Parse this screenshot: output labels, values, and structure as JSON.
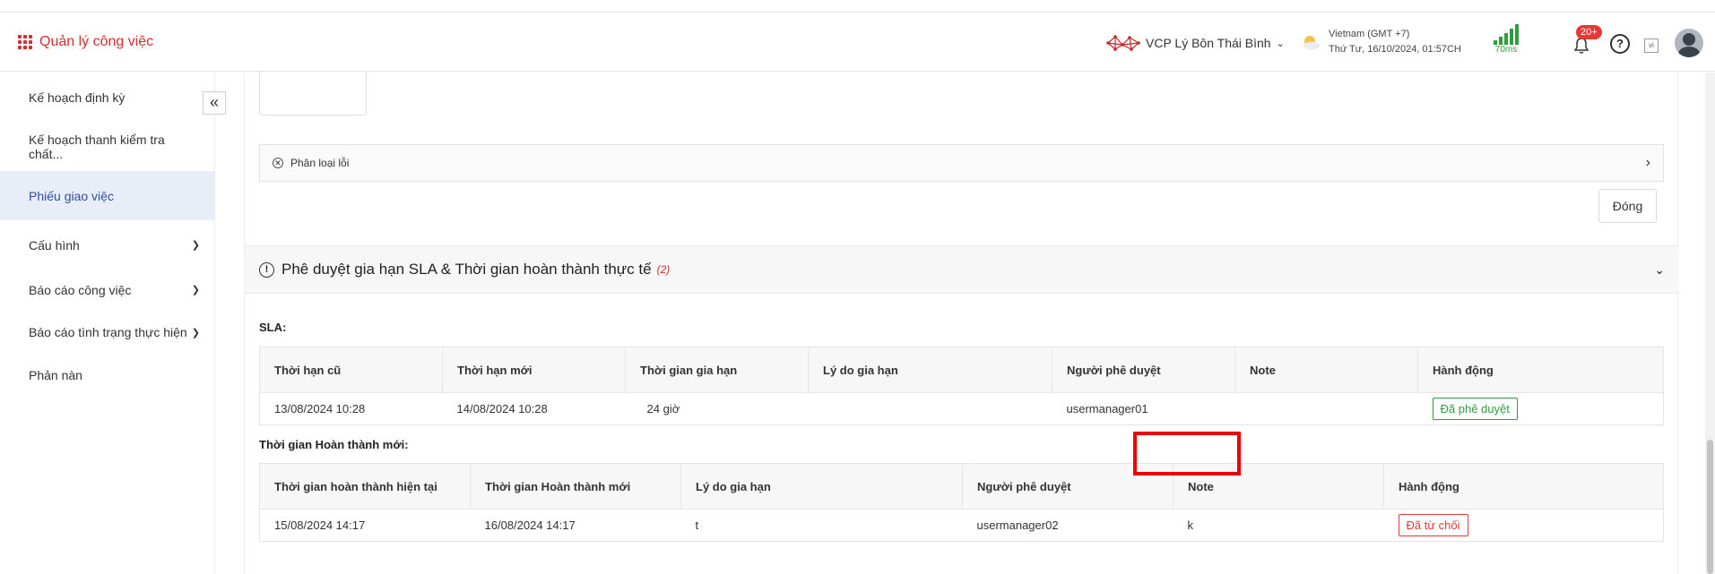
{
  "header": {
    "app_title": "Quản lý công việc",
    "org_name": "VCP Lý Bôn Thái Bình",
    "timezone": "Vietnam (GMT +7)",
    "datetime": "Thứ Tư, 16/10/2024, 01:57CH",
    "latency": "70ms",
    "notif_count": "20+",
    "help_glyph": "?",
    "lang_code": "vi"
  },
  "sidebar": {
    "items": [
      {
        "label": "Kế hoạch định kỳ"
      },
      {
        "label": "Kế hoạch thanh kiểm tra chất..."
      },
      {
        "label": "Phiếu giao việc"
      },
      {
        "label": "Cấu hình"
      },
      {
        "label": "Báo cáo công việc"
      },
      {
        "label": "Báo cáo tình trạng thực hiện"
      },
      {
        "label": "Phản nàn"
      }
    ],
    "collapse_glyph": "«"
  },
  "main": {
    "error_classification": "Phân loại lỗi",
    "close_label": "Đóng",
    "section": {
      "title": "Phê duyệt gia hạn SLA & Thời gian hoàn thành thực tế",
      "count": "(2)"
    },
    "sla": {
      "label": "SLA:",
      "headers": [
        "Thời hạn cũ",
        "Thời hạn mới",
        "Thời gian gia hạn",
        "Lý do gia hạn",
        "Người phê duyệt",
        "Note",
        "Hành động"
      ],
      "row": {
        "old": "13/08/2024 10:28",
        "new": "14/08/2024 10:28",
        "duration": "24 giờ",
        "reason": "",
        "approver": "usermanager01",
        "note": "",
        "action": "Đã phê duyệt"
      }
    },
    "completion": {
      "label": "Thời gian Hoàn thành mới:",
      "headers": [
        "Thời gian hoàn thành hiện tại",
        "Thời gian Hoàn thành mới",
        "Lý do gia hạn",
        "Người phê duyệt",
        "Note",
        "Hành động"
      ],
      "row": {
        "current": "15/08/2024 14:17",
        "new": "16/08/2024 14:17",
        "reason": "t",
        "approver": "usermanager02",
        "note": "k",
        "action": "Đã từ chối"
      }
    }
  },
  "colors": {
    "brand": "#d32f2f",
    "active_nav": "#2d4ea2",
    "approved": "#2e9e3d",
    "rejected": "#e53935"
  }
}
